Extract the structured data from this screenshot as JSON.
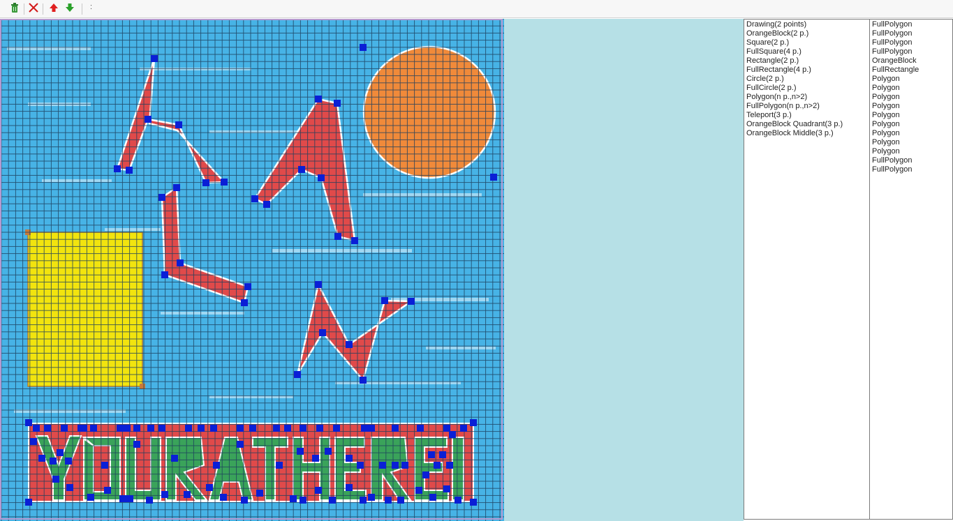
{
  "toolbar": {
    "buttons": [
      {
        "name": "trash-button",
        "icon": "trash-can-icon",
        "color": "#3a9a3a"
      },
      {
        "name": "close-button",
        "icon": "close-icon",
        "color": "#d21a1a"
      },
      {
        "name": "move-up-button",
        "icon": "arrow-up-icon",
        "color": "#e02020"
      },
      {
        "name": "move-down-button",
        "icon": "arrow-down-icon",
        "color": "#2aa02a"
      }
    ],
    "overflow_label": ":"
  },
  "colors": {
    "sky": "#47b3e6",
    "grid": "#1b3d5c",
    "polygon_fill": "#e04a4a",
    "vertex_handle": "#0a1fd6",
    "sun": "#f08a3a",
    "square": "#f2e40e",
    "panel": "#b6e0e6",
    "banner_letters": "#3aa35a"
  },
  "shape_types_list": [
    "Drawing(2 points)",
    "OrangeBlock(2 p.)",
    "Square(2 p.)",
    "FullSquare(4 p.)",
    "Rectangle(2 p.)",
    "FullRectangle(4 p.)",
    "Circle(2 p.)",
    "FullCircle(2 p.)",
    "Polygon(n p.,n>2)",
    "FullPolygon(n p.,n>2)",
    "Teleport(3 p.)",
    "OrangeBlock Quadrant(3 p.)",
    "OrangeBlock Middle(3 p.)"
  ],
  "shapes_list": [
    "FullPolygon",
    "FullPolygon",
    "FullPolygon",
    "FullPolygon",
    "OrangeBlock",
    "FullRectangle",
    "Polygon",
    "Polygon",
    "Polygon",
    "Polygon",
    "Polygon",
    "Polygon",
    "Polygon",
    "Polygon",
    "Polygon",
    "FullPolygon",
    "FullPolygon"
  ]
}
